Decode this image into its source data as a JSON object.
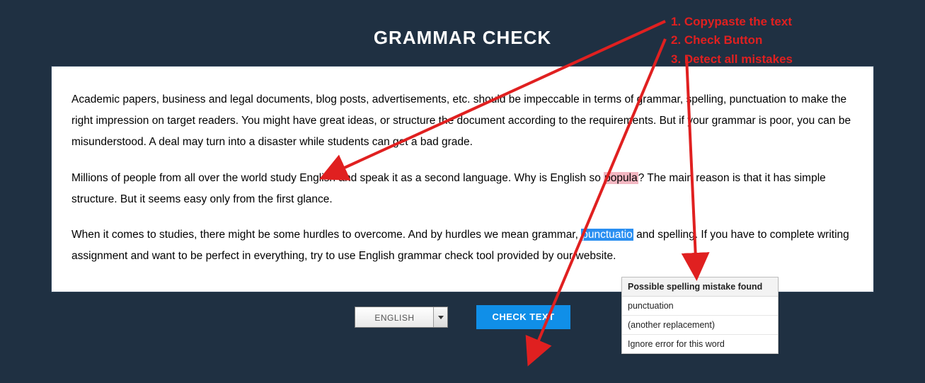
{
  "title": "GRAMMAR CHECK",
  "editor": {
    "p1_a": "Academic papers, business and legal documents, blog posts, advertisements, etc. should be impeccable in terms of grammar, spelling, punctuation to make the right impression on target readers. You might have great ideas, or structure the document according to the requirements. But if your grammar is poor, you can be misunderstood. A deal may turn into a disaster while students can get a bad grade.",
    "p2_a": "Millions of people from all over the world study English and speak it as a second language. Why is English so ",
    "p2_err": "popula",
    "p2_b": "? The main reason is that it has simple structure. But it seems easy only from the first glance.",
    "p3_a": "When it comes to studies, there might be some hurdles to overcome. And by hurdles we mean grammar, ",
    "p3_err": "punctuatio",
    "p3_b": " and spelling. If you have to complete writing assignment and want to be perfect in everything, try to use English grammar check tool provided by our website."
  },
  "tooltip": {
    "title": "Possible spelling mistake found",
    "opt1": "punctuation",
    "opt2": "(another replacement)",
    "opt3": "Ignore error for this word"
  },
  "controls": {
    "language": "ENGLISH",
    "check": "CHECK TEXT"
  },
  "annotations": {
    "l1": "1. Copypaste the text",
    "l2": "2. Check Button",
    "l3": "3. Detect all mistakes"
  }
}
